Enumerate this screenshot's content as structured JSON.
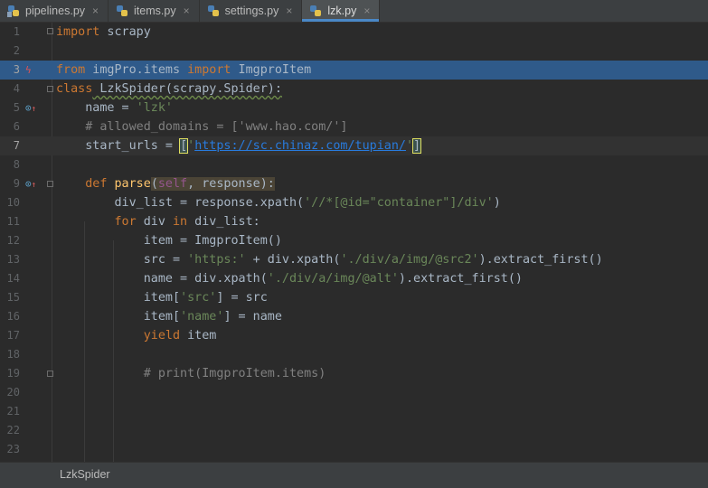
{
  "tabs": [
    {
      "label": "pipelines.py",
      "active": false
    },
    {
      "label": "items.py",
      "active": false
    },
    {
      "label": "settings.py",
      "active": false
    },
    {
      "label": "lzk.py",
      "active": true
    }
  ],
  "close_glyph": "×",
  "lines": [
    {
      "n": "1"
    },
    {
      "n": "2"
    },
    {
      "n": "3"
    },
    {
      "n": "4"
    },
    {
      "n": "5"
    },
    {
      "n": "6"
    },
    {
      "n": "7"
    },
    {
      "n": "8"
    },
    {
      "n": "9"
    },
    {
      "n": "10"
    },
    {
      "n": "11"
    },
    {
      "n": "12"
    },
    {
      "n": "13"
    },
    {
      "n": "14"
    },
    {
      "n": "15"
    },
    {
      "n": "16"
    },
    {
      "n": "17"
    },
    {
      "n": "18"
    },
    {
      "n": "19"
    },
    {
      "n": "20"
    },
    {
      "n": "21"
    },
    {
      "n": "22"
    },
    {
      "n": "23"
    }
  ],
  "code": {
    "l1_kw": "import",
    "l1_rest": " scrapy",
    "l3_kw1": "from",
    "l3_mid": " imgPro.items ",
    "l3_kw2": "import",
    "l3_cls": " ImgproItem",
    "l4_kw": "class",
    "l4_rest": " LzkSpider(scrapy.Spider):",
    "l5_a": "    name = ",
    "l5_str": "'lzk'",
    "l6_com": "    # allowed_domains = ['www.hao.com/']",
    "l7_a": "    start_urls = ",
    "l7_b1": "[",
    "l7_q1": "'",
    "l7_url": "https://sc.chinaz.com/tupian/",
    "l7_q2": "'",
    "l7_b2": "]",
    "l9_ind": "    ",
    "l9_kw": "def",
    "l9_fn": " parse",
    "l9_p1": "(",
    "l9_self": "self",
    "l9_p2": ", response",
    "l9_p3": "):",
    "l10_a": "        div_list = response.xpath(",
    "l10_str": "'//*[@id=\"container\"]/div'",
    "l10_b": ")",
    "l11_ind": "        ",
    "l11_kw1": "for",
    "l11_m": " div ",
    "l11_kw2": "in",
    "l11_r": " div_list:",
    "l12": "            item = ImgproItem()",
    "l13_a": "            src = ",
    "l13_s1": "'https:'",
    "l13_b": " + div.xpath(",
    "l13_s2": "'./div/a/img/@src2'",
    "l13_c": ").extract_first()",
    "l14_a": "            name = div.xpath(",
    "l14_s": "'./div/a/img/@alt'",
    "l14_c": ").extract_first()",
    "l15_a": "            item[",
    "l15_s": "'src'",
    "l15_c": "] = src",
    "l16_a": "            item[",
    "l16_s": "'name'",
    "l16_c": "] = name",
    "l17_ind": "            ",
    "l17_kw": "yield",
    "l17_r": " item",
    "l19_com": "            # print(ImgproItem.items)"
  },
  "breadcrumb": "LzkSpider",
  "colors": {
    "keyword": "#cc7832",
    "string": "#6a8759",
    "comment": "#808080",
    "selection": "#2f5a8a",
    "tab_accent": "#4a88c7"
  }
}
